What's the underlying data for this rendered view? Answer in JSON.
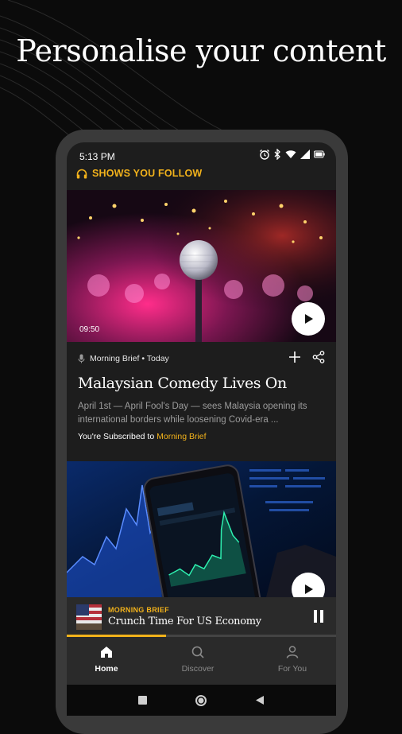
{
  "headline": "Personalise your content",
  "status_bar": {
    "time": "5:13 PM"
  },
  "section": {
    "label": "SHOWS YOU FOLLOW",
    "icon": "headphones-icon"
  },
  "episode": {
    "duration": "09:50",
    "show": "Morning Brief • Today",
    "title": "Malaysian Comedy Lives On",
    "description": "April 1st — April Fool's Day — sees Malaysia opening its international borders while loosening Covid-era ...",
    "subscribed_prefix": "You're Subscribed to ",
    "subscribed_show": "Morning Brief"
  },
  "mini_player": {
    "label": "MORNING BRIEF",
    "title": "Crunch Time For US Economy",
    "progress": 0.37
  },
  "nav": {
    "home": "Home",
    "discover": "Discover",
    "for_you": "For You"
  },
  "colors": {
    "accent": "#f2b21b",
    "background": "#0b0b0b",
    "surface": "#1d1d1d"
  }
}
